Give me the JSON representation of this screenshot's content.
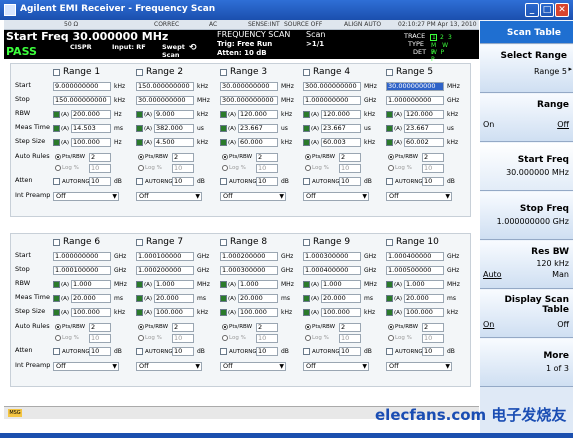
{
  "window": {
    "title": "Agilent EMI Receiver - Frequency Scan",
    "buttons": [
      "_",
      "□",
      "✕"
    ]
  },
  "status_bar": {
    "items": [
      "50 Ω",
      "CORREC",
      "AC",
      "SENSE:INT",
      "SOURCE OFF",
      "ALIGN AUTO"
    ],
    "datetime": "02:10:27 PM Apr 13, 2010"
  },
  "header": {
    "start_freq": "Start Freq  30.000000 MHz",
    "pass": "PASS",
    "cispr": "CISPR",
    "input": "Input: RF",
    "swept_scan": "Swept Scan",
    "mode": "FREQUENCY SCAN",
    "trig": "Trig: Free Run",
    "atten": "Atten: 10 dB",
    "scan": "Scan",
    "scan_count": ">1/1",
    "trace_label": "TRACE",
    "type_label": "TYPE",
    "det_label": "DET",
    "trace_digits": [
      "1",
      "2",
      "3"
    ],
    "type_marks": "M W W",
    "det_marks": "P P P"
  },
  "softkeys": {
    "title": "Scan Table",
    "items": [
      {
        "label": "Select Range",
        "value": "Range 5"
      },
      {
        "label": "Range",
        "left": "On",
        "right": "Off"
      },
      {
        "label": "Start Freq",
        "value": "30.000000 MHz"
      },
      {
        "label": "Stop Freq",
        "value": "1.000000000 GHz"
      },
      {
        "label": "Res BW",
        "value": "120 kHz",
        "left": "Auto",
        "right": "Man"
      },
      {
        "label": "Display Scan Table",
        "left": "On",
        "right": "Off"
      },
      {
        "label": "More",
        "value": "1 of 3"
      }
    ]
  },
  "row_labels": [
    "Start",
    "Stop",
    "RBW",
    "Meas Time",
    "Step Size",
    "Auto Rules",
    "Atten",
    "Int Preamp"
  ],
  "auto_rules_options": [
    "Pts/RBW",
    "Log %"
  ],
  "autorng_label": "AUTORNG",
  "preamp_value": "Off",
  "ranges_top": [
    {
      "name": "Range 1",
      "start": "9.000000000",
      "start_unit": "kHz",
      "stop": "150.000000000",
      "stop_unit": "kHz",
      "rbw": "200.000",
      "rbw_unit": "Hz",
      "meas": "14.503",
      "meas_unit": "ms",
      "step": "100.000",
      "step_unit": "Hz",
      "pts": "2",
      "log": "10",
      "atten": "10",
      "atten_unit": "dB"
    },
    {
      "name": "Range 2",
      "start": "150.000000000",
      "start_unit": "kHz",
      "stop": "30.000000000",
      "stop_unit": "MHz",
      "rbw": "9.000",
      "rbw_unit": "kHz",
      "meas": "382.000",
      "meas_unit": "us",
      "step": "4.500",
      "step_unit": "kHz",
      "pts": "2",
      "log": "10",
      "atten": "10",
      "atten_unit": "dB"
    },
    {
      "name": "Range 3",
      "start": "30.000000000",
      "start_unit": "MHz",
      "stop": "300.000000000",
      "stop_unit": "MHz",
      "rbw": "120.000",
      "rbw_unit": "kHz",
      "meas": "23.667",
      "meas_unit": "us",
      "step": "60.000",
      "step_unit": "kHz",
      "pts": "2",
      "log": "10",
      "atten": "10",
      "atten_unit": "dB"
    },
    {
      "name": "Range 4",
      "start": "300.000000000",
      "start_unit": "MHz",
      "stop": "1.000000000",
      "stop_unit": "GHz",
      "rbw": "120.000",
      "rbw_unit": "kHz",
      "meas": "23.667",
      "meas_unit": "us",
      "step": "60.003",
      "step_unit": "kHz",
      "pts": "2",
      "log": "10",
      "atten": "10",
      "atten_unit": "dB"
    },
    {
      "name": "Range 5",
      "start": "30.000000000",
      "start_unit": "MHz",
      "stop": "1.000000000",
      "stop_unit": "GHz",
      "rbw": "120.000",
      "rbw_unit": "kHz",
      "meas": "23.667",
      "meas_unit": "us",
      "step": "60.002",
      "step_unit": "kHz",
      "pts": "2",
      "log": "10",
      "atten": "10",
      "atten_unit": "dB"
    }
  ],
  "ranges_bottom": [
    {
      "name": "Range 6",
      "start": "1.000000000",
      "start_unit": "GHz",
      "stop": "1.000100000",
      "stop_unit": "GHz",
      "rbw": "1.000",
      "rbw_unit": "MHz",
      "meas": "20.000",
      "meas_unit": "ms",
      "step": "100.000",
      "step_unit": "kHz",
      "pts": "2",
      "log": "10",
      "atten": "10",
      "atten_unit": "dB"
    },
    {
      "name": "Range 7",
      "start": "1.000100000",
      "start_unit": "GHz",
      "stop": "1.000200000",
      "stop_unit": "GHz",
      "rbw": "1.000",
      "rbw_unit": "MHz",
      "meas": "20.000",
      "meas_unit": "ms",
      "step": "100.000",
      "step_unit": "kHz",
      "pts": "2",
      "log": "10",
      "atten": "10",
      "atten_unit": "dB"
    },
    {
      "name": "Range 8",
      "start": "1.000200000",
      "start_unit": "GHz",
      "stop": "1.000300000",
      "stop_unit": "GHz",
      "rbw": "1.000",
      "rbw_unit": "MHz",
      "meas": "20.000",
      "meas_unit": "ms",
      "step": "100.000",
      "step_unit": "kHz",
      "pts": "2",
      "log": "10",
      "atten": "10",
      "atten_unit": "dB"
    },
    {
      "name": "Range 9",
      "start": "1.000300000",
      "start_unit": "GHz",
      "stop": "1.000400000",
      "stop_unit": "GHz",
      "rbw": "1.000",
      "rbw_unit": "MHz",
      "meas": "20.000",
      "meas_unit": "ms",
      "step": "100.000",
      "step_unit": "kHz",
      "pts": "2",
      "log": "10",
      "atten": "10",
      "atten_unit": "dB"
    },
    {
      "name": "Range 10",
      "start": "1.000400000",
      "start_unit": "GHz",
      "stop": "1.000500000",
      "stop_unit": "GHz",
      "rbw": "1.000",
      "rbw_unit": "MHz",
      "meas": "20.000",
      "meas_unit": "ms",
      "step": "100.000",
      "step_unit": "kHz",
      "pts": "2",
      "log": "10",
      "atten": "10",
      "atten_unit": "dB"
    }
  ],
  "footer": {
    "msg": "MSG"
  },
  "watermark": "elecfans.com 电子发烧友",
  "colors": {
    "title_bar": "#1b4fae",
    "pass": "#3cff3c",
    "highlight": "#2f63c8",
    "softkey_title": "#1f6fd1"
  }
}
